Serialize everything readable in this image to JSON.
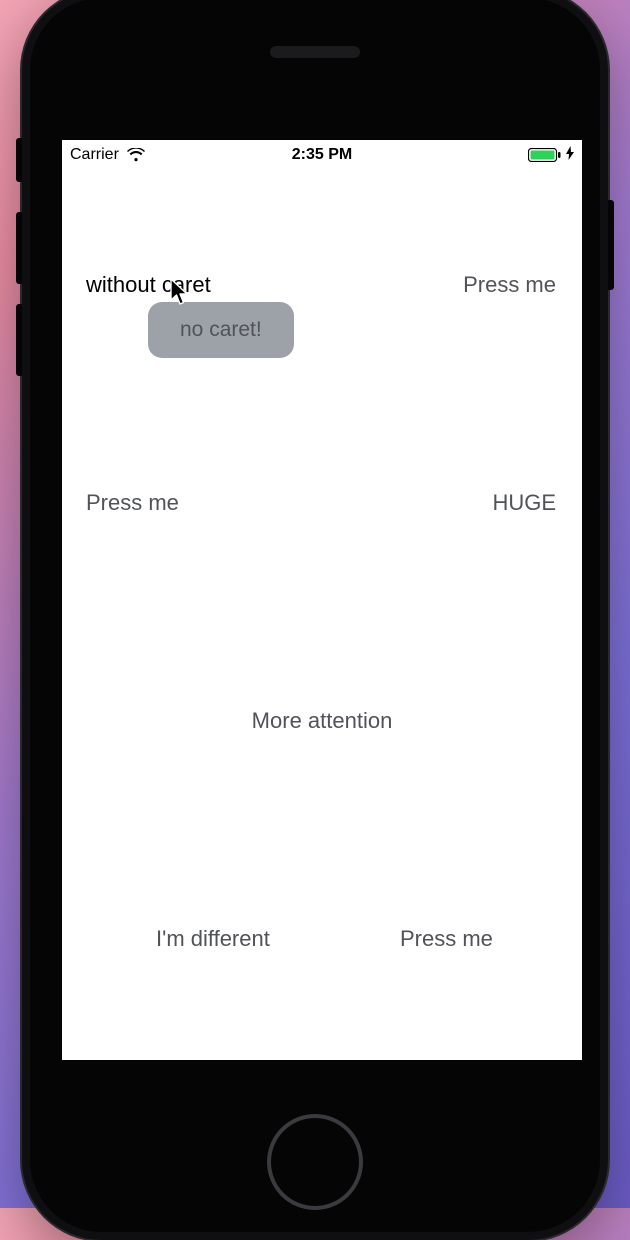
{
  "status": {
    "carrier": "Carrier",
    "time": "2:35 PM"
  },
  "buttons": {
    "without_caret": "without caret",
    "press_me_tr": "Press me",
    "press_me_ml": "Press me",
    "huge": "HUGE",
    "more_attention": "More attention",
    "im_different": "I'm different",
    "press_me_br": "Press me"
  },
  "tooltip": {
    "text": "no caret!"
  }
}
